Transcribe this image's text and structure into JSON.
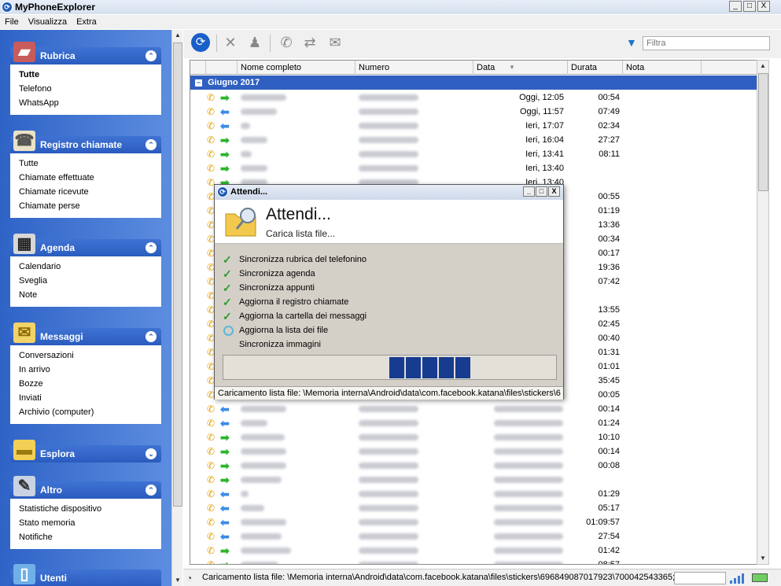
{
  "window": {
    "title": "MyPhoneExplorer",
    "btn_min": "_",
    "btn_max": "□",
    "btn_close": "X"
  },
  "menu": [
    "File",
    "Visualizza",
    "Extra"
  ],
  "sidebar": {
    "panels": [
      {
        "title": "Rubrica",
        "chevron": "⌃",
        "items": [
          {
            "label": "Tutte",
            "active": true
          },
          {
            "label": "Telefono"
          },
          {
            "label": "WhatsApp"
          }
        ]
      },
      {
        "title": "Registro chiamate",
        "chevron": "⌃",
        "items": [
          {
            "label": "Tutte"
          },
          {
            "label": "Chiamate effettuate"
          },
          {
            "label": "Chiamate ricevute"
          },
          {
            "label": "Chiamate perse"
          }
        ]
      },
      {
        "title": "Agenda",
        "chevron": "⌃",
        "items": [
          {
            "label": "Calendario"
          },
          {
            "label": "Sveglia"
          },
          {
            "label": "Note"
          }
        ]
      },
      {
        "title": "Messaggi",
        "chevron": "⌃",
        "items": [
          {
            "label": "Conversazioni"
          },
          {
            "label": "In arrivo"
          },
          {
            "label": "Bozze"
          },
          {
            "label": "Inviati"
          },
          {
            "label": "Archivio (computer)"
          }
        ]
      },
      {
        "title": "Esplora",
        "chevron": "⌄",
        "items": []
      },
      {
        "title": "Altro",
        "chevron": "⌃",
        "items": [
          {
            "label": "Statistiche dispositivo"
          },
          {
            "label": "Stato memoria"
          },
          {
            "label": "Notifiche"
          }
        ]
      },
      {
        "title": "Utenti",
        "chevron": "",
        "items": []
      }
    ]
  },
  "toolbar": {
    "filter_placeholder": "Filtra"
  },
  "grid": {
    "columns": [
      "Nome completo",
      "Numero",
      "Data",
      "Durata",
      "Nota"
    ],
    "group_label": "Giugno 2017",
    "rows": [
      {
        "dir": "out",
        "date": "Oggi, 12:05",
        "dur": "00:54"
      },
      {
        "dir": "in",
        "date": "Oggi, 11:57",
        "dur": "07:49"
      },
      {
        "dir": "in",
        "date": "Ieri, 17:07",
        "dur": "02:34"
      },
      {
        "dir": "out",
        "date": "Ieri, 16:04",
        "dur": "27:27"
      },
      {
        "dir": "out",
        "date": "Ieri, 13:41",
        "dur": "08:11"
      },
      {
        "dir": "out",
        "date": "Ieri, 13:40",
        "dur": ""
      },
      {
        "dir": "out",
        "date": "Ieri, 13:40",
        "dur": ""
      },
      {
        "dir": "out",
        "date": "",
        "dur": "00:55"
      },
      {
        "dir": "out",
        "date": "",
        "dur": "01:19"
      },
      {
        "dir": "out",
        "date": "",
        "dur": "13:36"
      },
      {
        "dir": "out",
        "date": "",
        "dur": "00:34"
      },
      {
        "dir": "out",
        "date": "",
        "dur": "00:17"
      },
      {
        "dir": "out",
        "date": "",
        "dur": "19:36"
      },
      {
        "dir": "out",
        "date": "",
        "dur": "07:42"
      },
      {
        "dir": "out",
        "date": "",
        "dur": ""
      },
      {
        "dir": "out",
        "date": "",
        "dur": "13:55"
      },
      {
        "dir": "out",
        "date": "",
        "dur": "02:45"
      },
      {
        "dir": "out",
        "date": "",
        "dur": "00:40"
      },
      {
        "dir": "out",
        "date": "",
        "dur": "01:31"
      },
      {
        "dir": "out",
        "date": "",
        "dur": "01:01"
      },
      {
        "dir": "out",
        "date": "",
        "dur": "35:45"
      },
      {
        "dir": "out",
        "date": "",
        "dur": "00:05"
      },
      {
        "dir": "in",
        "date": "",
        "dur": "00:14"
      },
      {
        "dir": "in",
        "date": "",
        "dur": "01:24"
      },
      {
        "dir": "out",
        "date": "",
        "dur": "10:10"
      },
      {
        "dir": "out",
        "date": "",
        "dur": "00:14"
      },
      {
        "dir": "out",
        "date": "",
        "dur": "00:08"
      },
      {
        "dir": "out",
        "date": "",
        "dur": ""
      },
      {
        "dir": "in",
        "date": "",
        "dur": "01:29"
      },
      {
        "dir": "in",
        "date": "",
        "dur": "05:17"
      },
      {
        "dir": "in",
        "date": "",
        "dur": "01:09:57"
      },
      {
        "dir": "in",
        "date": "",
        "dur": "27:54"
      },
      {
        "dir": "out",
        "date": "",
        "dur": "01:42"
      },
      {
        "dir": "out",
        "date": "",
        "dur": "08:57"
      }
    ]
  },
  "statusbar": {
    "text": "Caricamento lista file: \\Memoria interna\\Android\\data\\com.facebook.katana\\files\\stickers\\696849087017923\\700042543365;"
  },
  "dialog": {
    "title": "Attendi...",
    "heading": "Attendi...",
    "subheading": "Carica lista file...",
    "steps": [
      {
        "label": "Sincronizza rubrica del telefonino",
        "state": "done"
      },
      {
        "label": "Sincronizza agenda",
        "state": "done"
      },
      {
        "label": "Sincronizza appunti",
        "state": "done"
      },
      {
        "label": "Aggiorna il registro chiamate",
        "state": "done"
      },
      {
        "label": "Aggiorna la cartella dei messaggi",
        "state": "done"
      },
      {
        "label": "Aggiorna la lista dei file",
        "state": "working"
      },
      {
        "label": "Sincronizza immagini",
        "state": "pending"
      }
    ],
    "progress_blocks": 5,
    "status_text": "Caricamento lista file: \\Memoria interna\\Android\\data\\com.facebook.katana\\files\\stickers\\6"
  },
  "colors": {
    "sidebar_bg": "#2f63c6",
    "group_row": "#2f5fc0",
    "progress_block": "#173c8f",
    "outgoing_arrow": "#2db52d",
    "incoming_arrow": "#3c8be6",
    "phone_icon": "#e2a000"
  }
}
